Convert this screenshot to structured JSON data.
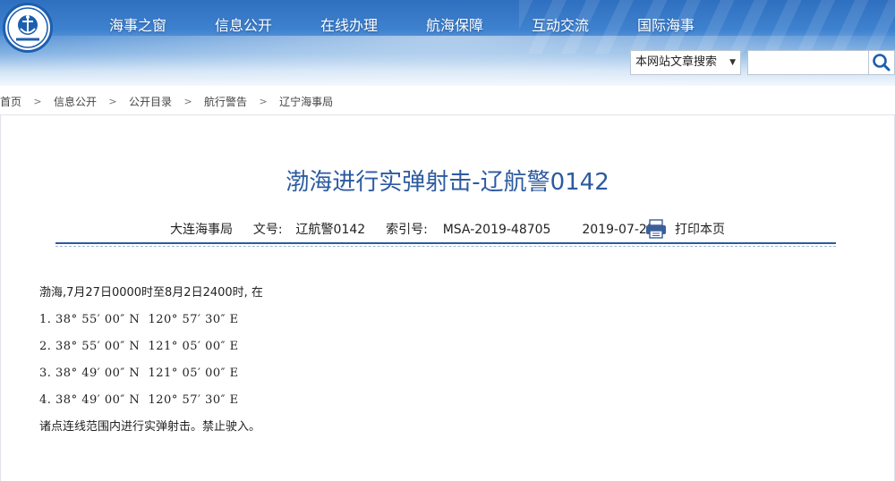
{
  "header": {
    "logo_alt": "CHINA MSA",
    "nav": [
      "海事之窗",
      "信息公开",
      "在线办理",
      "航海保障",
      "互动交流",
      "国际海事"
    ]
  },
  "search": {
    "scope_label": "本网站文章搜索",
    "placeholder": "",
    "icon": "search-icon"
  },
  "breadcrumb": {
    "items": [
      "首页",
      "信息公开",
      "公开目录",
      "航行警告",
      "辽宁海事局"
    ],
    "separator": ">"
  },
  "article": {
    "title": "渤海进行实弹射击-辽航警0142",
    "agency": "大连海事局",
    "doc_no_label": "文号:",
    "doc_no": "辽航警0142",
    "index_label": "索引号:",
    "index_no": "MSA-2019-48705",
    "date": "2019-07-25",
    "print_label": "打印本页",
    "body": {
      "intro": "渤海,7月27日0000时至8月2日2400时, 在",
      "points": [
        "1. 38° 55′ 00″ N  120° 57′ 30″ E",
        "2. 38° 55′ 00″ N  121° 05′ 00″ E",
        "3. 38° 49′ 00″ N  121° 05′ 00″ E",
        "4. 38° 49′ 00″ N  120° 57′ 30″ E"
      ],
      "conclusion": "诸点连线范围内进行实弹射击。禁止驶入。"
    }
  },
  "colors": {
    "title": "#2c5aa0",
    "banner_top": "#2f6fbf",
    "divider": "#2c5aa0"
  }
}
